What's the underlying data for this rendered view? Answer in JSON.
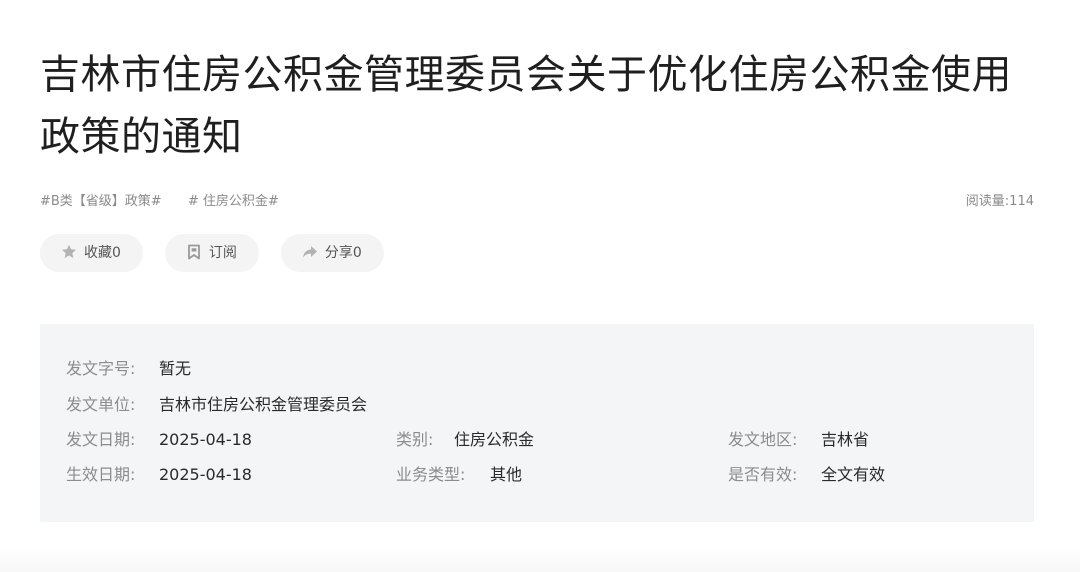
{
  "article": {
    "title": "吉林市住房公积金管理委员会关于优化住房公积金使用政策的通知",
    "tags": [
      "#B类【省级】政策#",
      "# 住房公积金#"
    ],
    "read_count": "阅读量:114"
  },
  "actions": {
    "favorite": {
      "label": "收藏0",
      "icon": "star-icon"
    },
    "subscribe": {
      "label": "订阅",
      "icon": "bookmark-icon"
    },
    "share": {
      "label": "分享0",
      "icon": "share-icon"
    }
  },
  "info": {
    "doc_number": {
      "label": "发文字号:",
      "value": "暂无"
    },
    "issuer": {
      "label": "发文单位:",
      "value": "吉林市住房公积金管理委员会"
    },
    "issue_date": {
      "label": "发文日期:",
      "value": "2025-04-18"
    },
    "category": {
      "label": "类别:",
      "value": "住房公积金"
    },
    "region": {
      "label": "发文地区:",
      "value": "吉林省"
    },
    "effective_date": {
      "label": "生效日期:",
      "value": "2025-04-18"
    },
    "business_type": {
      "label": "业务类型:",
      "value": "其他"
    },
    "validity": {
      "label": "是否有效:",
      "value": "全文有效"
    }
  },
  "colors": {
    "panel_bg": "#f4f5f7",
    "button_bg": "#f4f4f4",
    "label_gray": "#8c8c8c",
    "text_dark": "#1f1f1f"
  }
}
